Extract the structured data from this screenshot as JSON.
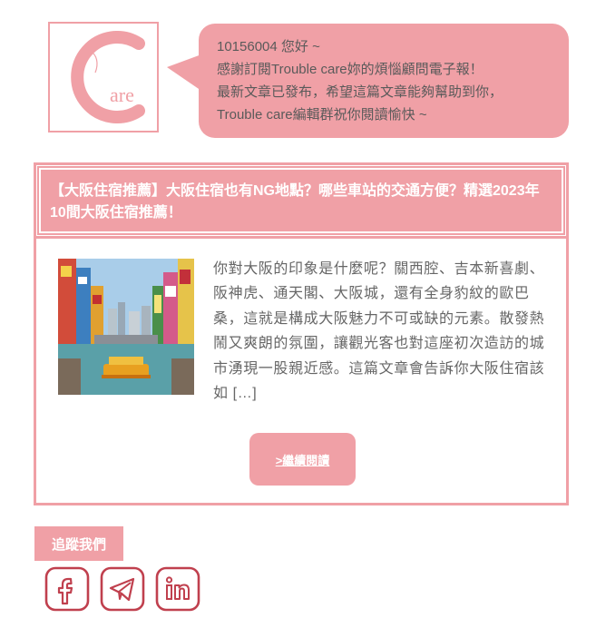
{
  "colors": {
    "accent": "#f0a0a6",
    "icon_stroke": "#c0404e",
    "text": "#5a5a5a"
  },
  "logo": {
    "letter": "C",
    "word": "are"
  },
  "greeting": {
    "line1": "10156004 您好 ~",
    "line2": "感謝訂閱Trouble care妳的煩惱顧問電子報！",
    "line3": "最新文章已發布，希望這篇文章能夠幫助到你，",
    "line4": "Trouble care編輯群祝你閱讀愉快 ~"
  },
  "article": {
    "title": "【大阪住宿推薦】大阪住宿也有NG地點？哪些車站的交通方便？精選2023年10間大阪住宿推薦！",
    "excerpt": "你對大阪的印象是什麼呢？關西腔、吉本新喜劇、阪神虎、通天閣、大阪城，還有全身豹紋的歐巴桑，這就是構成大阪魅力不可或缺的元素。散發熱鬧又爽朗的氛圍，讓觀光客也對這座初次造訪的城市湧現一股親近感。這篇文章會告訴你大阪住宿該如 […]",
    "read_more": ">繼續閱讀"
  },
  "follow": {
    "label": "追蹤我們",
    "icons": [
      "facebook-icon",
      "telegram-icon",
      "linkedin-icon"
    ]
  }
}
